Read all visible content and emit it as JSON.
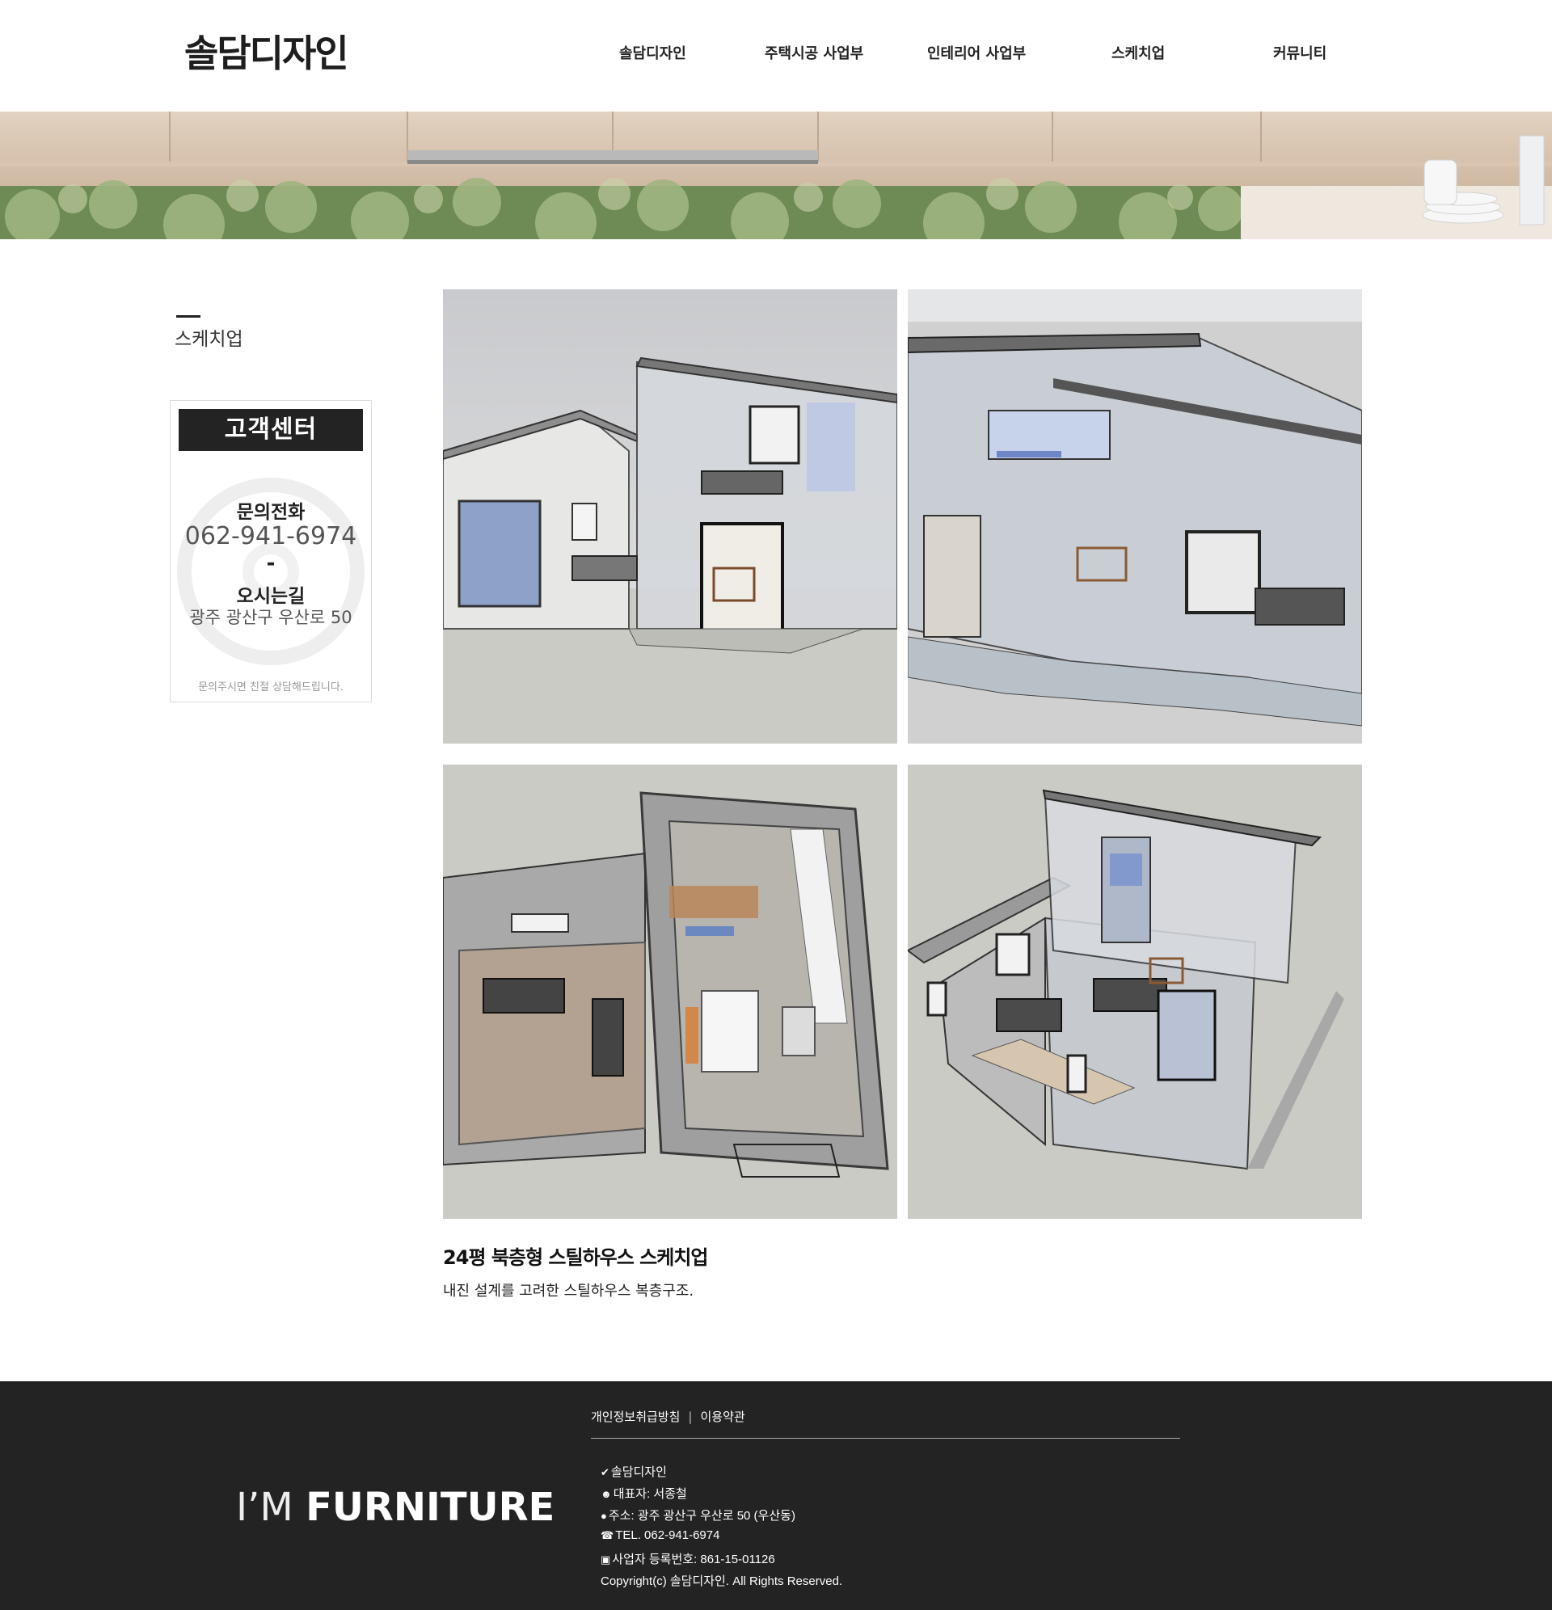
{
  "header": {
    "logo": "솔담디자인",
    "nav": [
      {
        "label": "솔담디자인"
      },
      {
        "label": "주택시공 사업부"
      },
      {
        "label": "인테리어 사업부"
      },
      {
        "label": "스케치업"
      },
      {
        "label": "커뮤니티"
      }
    ]
  },
  "sidebar": {
    "title": "스케치업",
    "customer_center": {
      "header": "고객센터",
      "inquiry_label": "문의전화",
      "phone": "062-941-6974",
      "separator": "-",
      "directions_label": "오시는길",
      "address": "광주 광산구 우산로 50",
      "note": "문의주시면 친절 상담해드립니다."
    }
  },
  "post": {
    "title": "24평 북층형 스틸하우스 스케치업",
    "description": "내진 설계를 고려한 스틸하우스 복층구조."
  },
  "footer": {
    "brand_thin": "I’M ",
    "brand_bold": "FURNITURE",
    "links": [
      "개인정보취급방침",
      "이용약관"
    ],
    "link_separator": "|",
    "company": "솔담디자인",
    "ceo": "대표자: 서종철",
    "address": "주소: 광주 광산구 우산로 50 (우산동)",
    "tel": "TEL. 062-941-6974",
    "business_no": "사업자 등록번호: 861-15-01126",
    "copyright": "Copyright(c) 솔담디자인. All Rights Reserved.",
    "icons": [
      "check-circle-icon",
      "user-check-icon",
      "map-marker-icon",
      "phone-icon",
      "id-card-icon"
    ]
  }
}
